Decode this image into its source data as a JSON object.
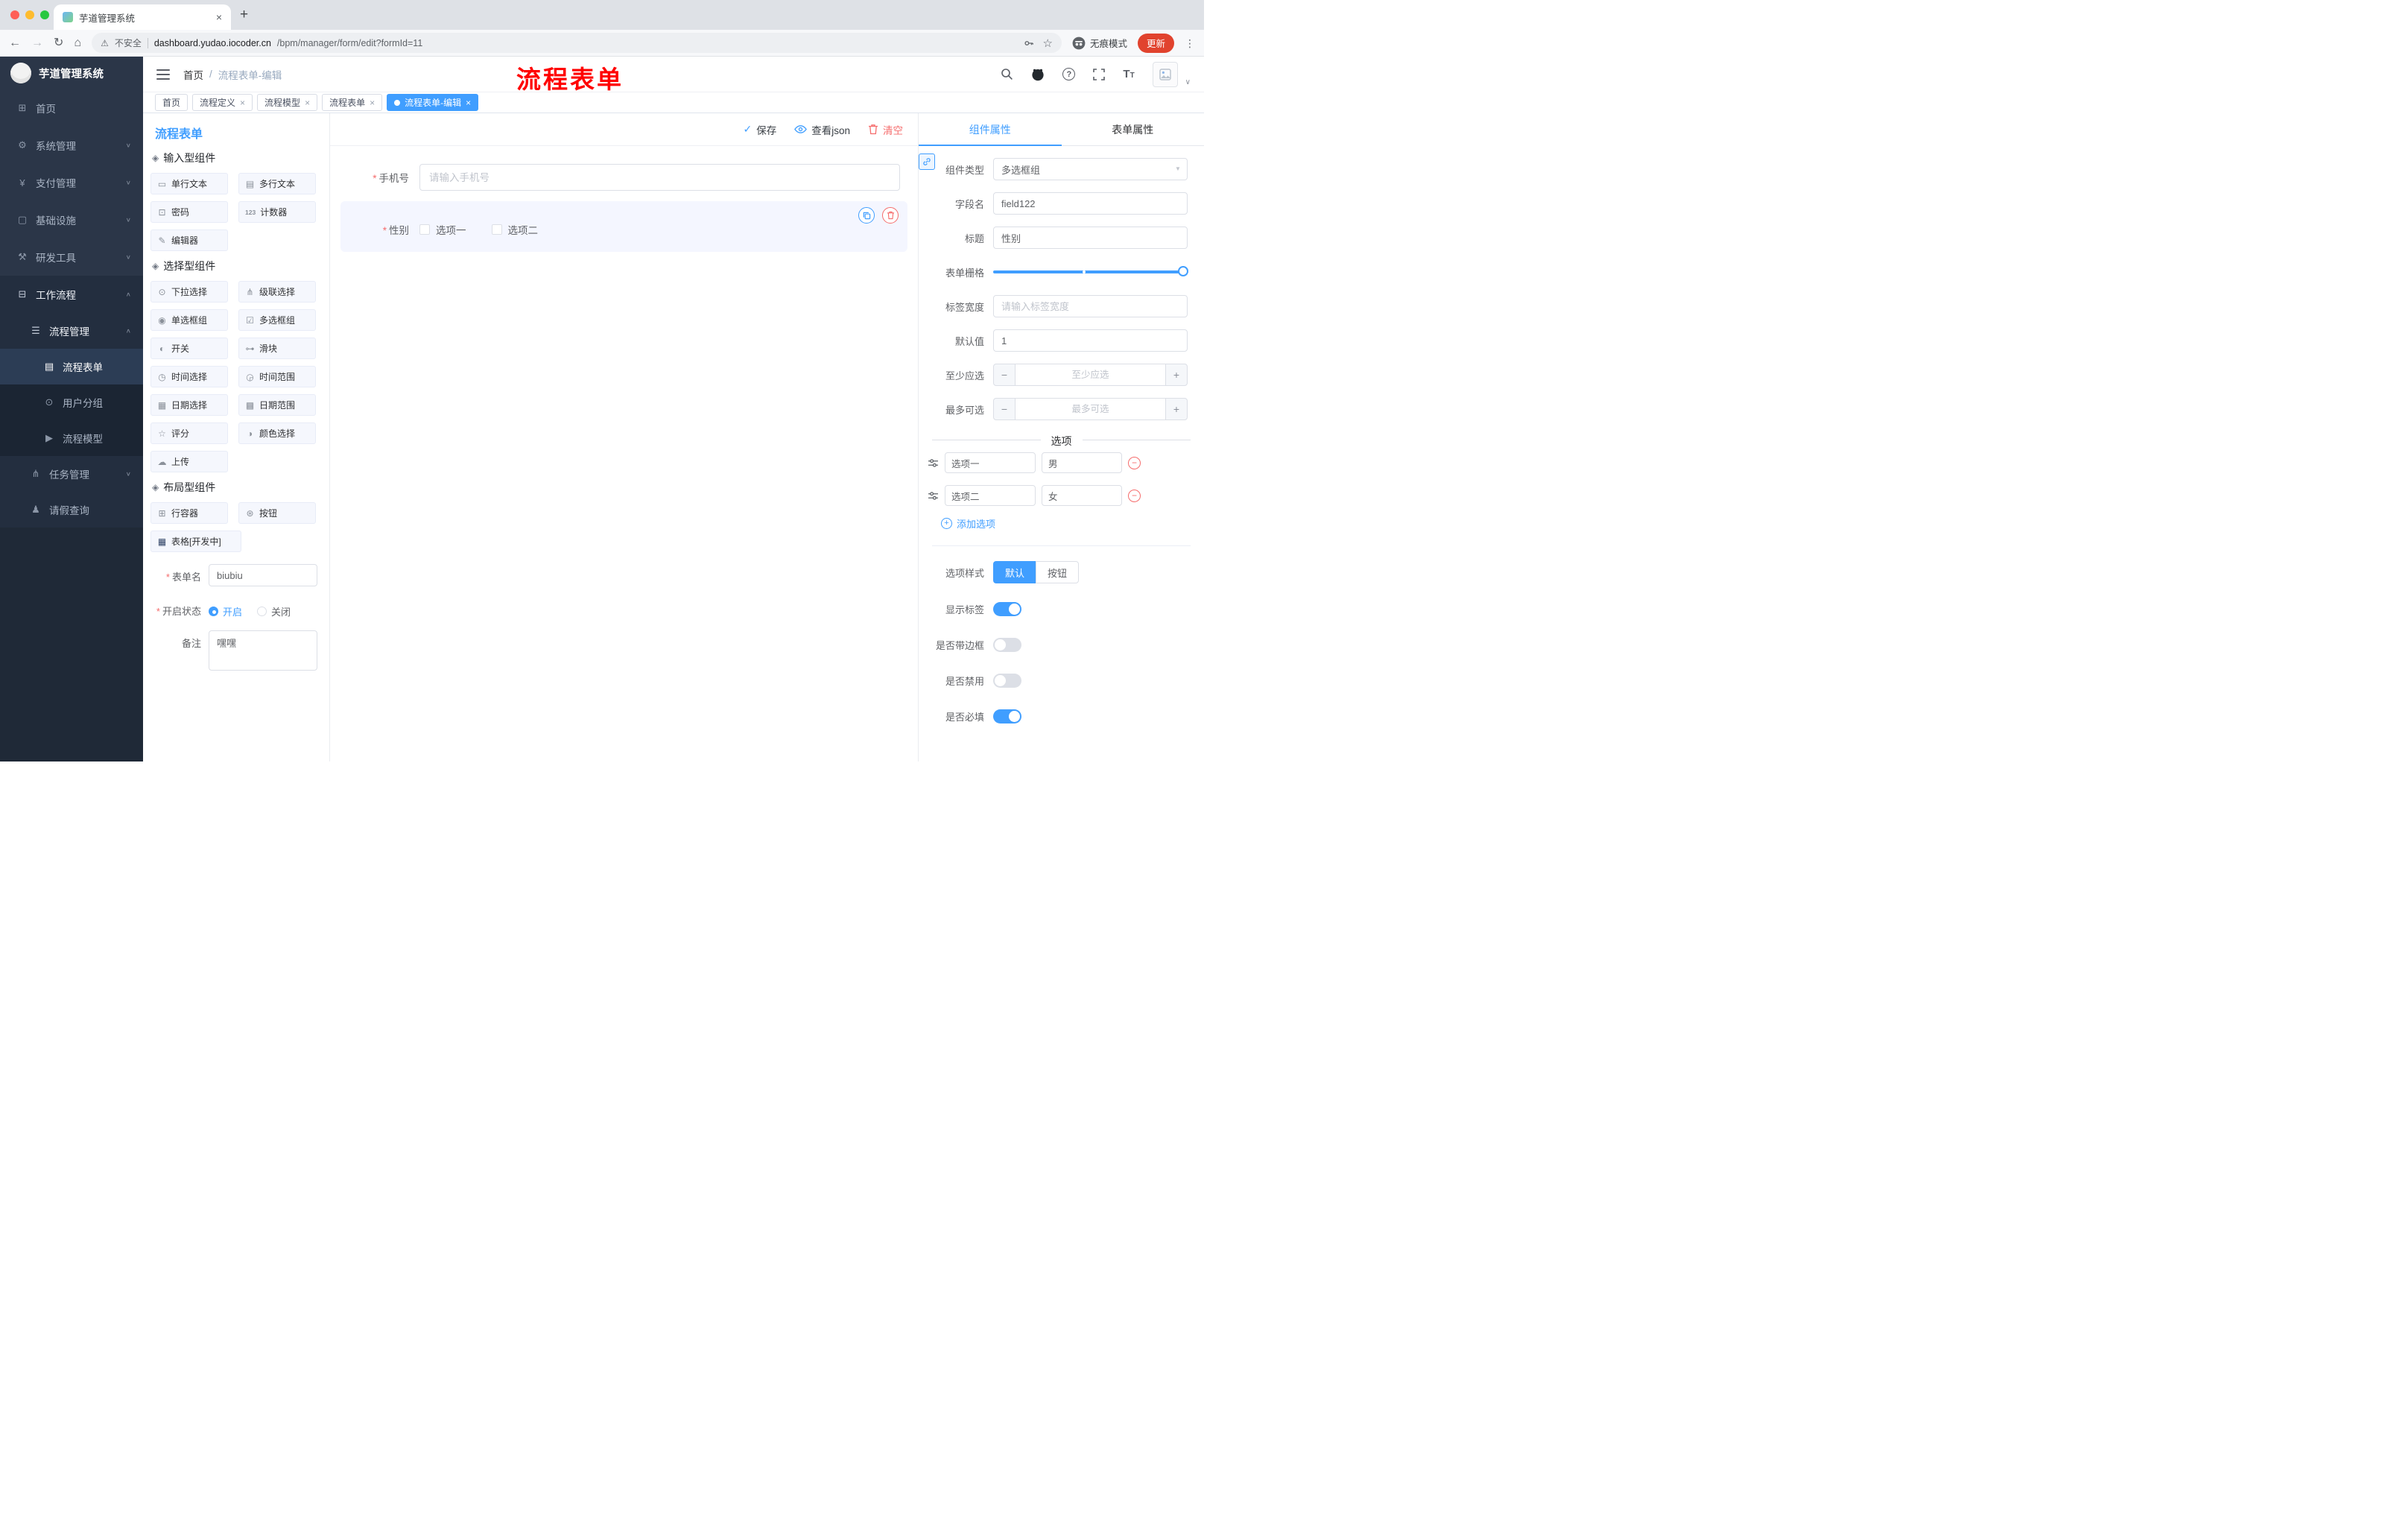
{
  "colors": {
    "primary": "#409eff",
    "danger": "#f56c6c",
    "annotation": "#ff0000"
  },
  "browser": {
    "tab": {
      "title": "芋道管理系统"
    },
    "toolbar": {
      "security": "不安全",
      "url_host": "dashboard.yudao.iocoder.cn",
      "url_path": "/bpm/manager/form/edit?formId=11",
      "incognito": "无痕模式",
      "update": "更新"
    }
  },
  "sidebar": {
    "logo_title": "芋道管理系统",
    "items": [
      {
        "label": "首页",
        "icon": "dashboard-icon"
      },
      {
        "label": "系统管理",
        "icon": "gear-icon"
      },
      {
        "label": "支付管理",
        "icon": "yen-icon"
      },
      {
        "label": "基础设施",
        "icon": "monitor-icon"
      },
      {
        "label": "研发工具",
        "icon": "toolbox-icon"
      },
      {
        "label": "工作流程",
        "icon": "workflow-icon"
      },
      {
        "label": "流程管理",
        "icon": "tree-icon"
      },
      {
        "label": "流程表单",
        "icon": "form-icon"
      },
      {
        "label": "用户分组",
        "icon": "users-icon"
      },
      {
        "label": "流程模型",
        "icon": "send-icon"
      },
      {
        "label": "任务管理",
        "icon": "tasks-icon"
      },
      {
        "label": "请假查询",
        "icon": "user-icon"
      }
    ]
  },
  "header": {
    "breadcrumb": {
      "root": "首页",
      "separator": "/",
      "current": "流程表单-编辑"
    },
    "annotation": "流程表单"
  },
  "tabs_bar": {
    "tabs": [
      {
        "label": "首页"
      },
      {
        "label": "流程定义"
      },
      {
        "label": "流程模型"
      },
      {
        "label": "流程表单"
      },
      {
        "label": "流程表单-编辑"
      }
    ]
  },
  "designer": {
    "title": "流程表单",
    "actions": {
      "save": "保存",
      "view_json": "查看json",
      "clear": "清空"
    },
    "palette": {
      "groups": [
        {
          "title": "输入型组件",
          "icon": "component-icon",
          "items": [
            {
              "label": "单行文本",
              "icon": "single-line-icon"
            },
            {
              "label": "多行文本",
              "icon": "textarea-icon"
            },
            {
              "label": "密码",
              "icon": "lock-icon"
            },
            {
              "label": "计数器",
              "icon": "counter-icon"
            },
            {
              "label": "编辑器",
              "icon": "editor-icon"
            }
          ]
        },
        {
          "title": "选择型组件",
          "icon": "component-icon",
          "items": [
            {
              "label": "下拉选择",
              "icon": "select-icon"
            },
            {
              "label": "级联选择",
              "icon": "cascade-icon"
            },
            {
              "label": "单选框组",
              "icon": "radio-icon"
            },
            {
              "label": "多选框组",
              "icon": "checkbox-icon"
            },
            {
              "label": "开关",
              "icon": "switch-icon"
            },
            {
              "label": "滑块",
              "icon": "slider-icon"
            },
            {
              "label": "时间选择",
              "icon": "time-icon"
            },
            {
              "label": "时间范围",
              "icon": "time-range-icon"
            },
            {
              "label": "日期选择",
              "icon": "date-icon"
            },
            {
              "label": "日期范围",
              "icon": "date-range-icon"
            },
            {
              "label": "评分",
              "icon": "rate-icon"
            },
            {
              "label": "颜色选择",
              "icon": "color-icon"
            },
            {
              "label": "上传",
              "icon": "upload-icon"
            }
          ]
        },
        {
          "title": "布局型组件",
          "icon": "component-icon",
          "items": [
            {
              "label": "行容器",
              "icon": "row-icon"
            },
            {
              "label": "按钮",
              "icon": "button-icon"
            },
            {
              "label": "表格[开发中]",
              "icon": "table-icon"
            }
          ]
        }
      ]
    },
    "meta_form": {
      "form_name_label": "表单名",
      "form_name_value": "biubiu",
      "status_label": "开启状态",
      "status_options": [
        {
          "label": "开启"
        },
        {
          "label": "关闭"
        }
      ],
      "remark_label": "备注",
      "remark_value": "嘿嘿"
    },
    "canvas": {
      "phone": {
        "label": "手机号",
        "placeholder": "请输入手机号"
      },
      "gender": {
        "label": "性别",
        "options": [
          "选项一",
          "选项二"
        ]
      }
    }
  },
  "properties": {
    "tabs": [
      {
        "label": "组件属性"
      },
      {
        "label": "表单属性"
      }
    ],
    "fields": {
      "type_label": "组件类型",
      "type_value": "多选框组",
      "field_label": "字段名",
      "field_value": "field122",
      "title_label": "标题",
      "title_value": "性别",
      "grid_label": "表单栅格",
      "tag_width_label": "标签宽度",
      "tag_width_placeholder": "请输入标签宽度",
      "default_label": "默认值",
      "default_value": "1",
      "min_label": "至少应选",
      "min_placeholder": "至少应选",
      "max_label": "最多可选",
      "max_placeholder": "最多可选"
    },
    "options_section": {
      "title": "选项",
      "rows": [
        {
          "label": "选项一",
          "value": "男"
        },
        {
          "label": "选项二",
          "value": "女"
        }
      ],
      "add_label": "添加选项"
    },
    "style_row": {
      "label": "选项样式",
      "options": [
        {
          "label": "默认"
        },
        {
          "label": "按钮"
        }
      ]
    },
    "switches": [
      {
        "label": "显示标签",
        "on": true
      },
      {
        "label": "是否带边框",
        "on": false
      },
      {
        "label": "是否禁用",
        "on": false
      },
      {
        "label": "是否必填",
        "on": true
      }
    ]
  }
}
